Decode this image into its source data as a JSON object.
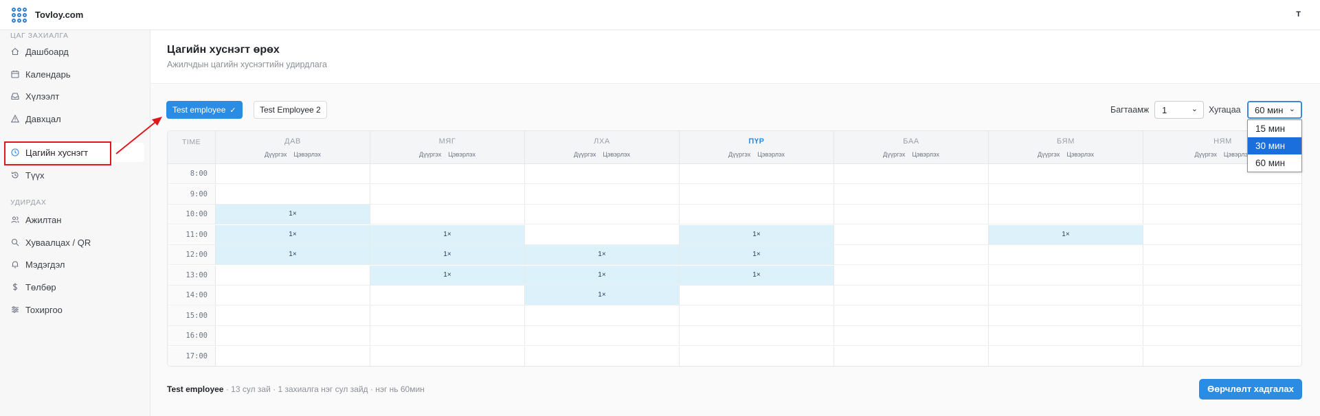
{
  "app": {
    "brand": "Tovloy.com",
    "user_initial": "T"
  },
  "sidebar": {
    "section1": "ЦАГ ЗАХИАЛГА",
    "section2": "УДИРДАХ",
    "items": [
      {
        "label": "Дашбоард",
        "icon": "home-icon"
      },
      {
        "label": "Календарь",
        "icon": "calendar-icon"
      },
      {
        "label": "Хүлээлт",
        "icon": "inbox-icon"
      },
      {
        "label": "Давхцал",
        "icon": "warning-icon"
      },
      {
        "label": "Цагийн хуснэгт",
        "icon": "clock-icon",
        "active": true
      },
      {
        "label": "Түүх",
        "icon": "history-icon"
      },
      {
        "label": "Ажилтан",
        "icon": "users-icon"
      },
      {
        "label": "Хуваалцах / QR",
        "icon": "search-icon"
      },
      {
        "label": "Мэдэгдэл",
        "icon": "bell-icon"
      },
      {
        "label": "Төлбөр",
        "icon": "dollar-icon"
      },
      {
        "label": "Тохиргоо",
        "icon": "sliders-icon"
      }
    ]
  },
  "page": {
    "title": "Цагийн хуснэгт өрөх",
    "subtitle": "Ажилчдын цагийн хуснэгтийн удирдлага"
  },
  "employees": [
    {
      "label": "Test employee",
      "selected": true
    },
    {
      "label": "Test Employee 2",
      "selected": false
    }
  ],
  "controls": {
    "capacity_label": "Багтаамж",
    "capacity_value": "1",
    "duration_label": "Хугацаа",
    "duration_value": "60 мин",
    "duration_options": [
      "15 мин",
      "30 мин",
      "60 мин"
    ],
    "highlighted_option": "30 мин"
  },
  "schedule": {
    "time_header": "TIME",
    "sub_labels": [
      "Дүүргэх",
      "Цэвэрлэх"
    ],
    "days": [
      "ДАВ",
      "МЯГ",
      "ЛХА",
      "ПҮР",
      "БАА",
      "БЯМ",
      "НЯМ"
    ],
    "today_index": 3,
    "times": [
      "8:00",
      "9:00",
      "10:00",
      "11:00",
      "12:00",
      "13:00",
      "14:00",
      "15:00",
      "16:00",
      "17:00"
    ],
    "cells": [
      [
        "",
        "",
        "",
        "",
        "",
        "",
        ""
      ],
      [
        "",
        "",
        "",
        "",
        "",
        "",
        ""
      ],
      [
        "1×",
        "",
        "",
        "",
        "",
        "",
        ""
      ],
      [
        "1×",
        "1×",
        "",
        "1×",
        "",
        "1×",
        ""
      ],
      [
        "1×",
        "1×",
        "1×",
        "1×",
        "",
        "",
        ""
      ],
      [
        "",
        "1×",
        "1×",
        "1×",
        "",
        "",
        ""
      ],
      [
        "",
        "",
        "1×",
        "",
        "",
        "",
        ""
      ],
      [
        "",
        "",
        "",
        "",
        "",
        "",
        ""
      ],
      [
        "",
        "",
        "",
        "",
        "",
        "",
        ""
      ],
      [
        "",
        "",
        "",
        "",
        "",
        "",
        ""
      ]
    ]
  },
  "footer": {
    "employee": "Test employee",
    "info": " · 13 сул зай · 1 захиалга нэг сул зайд · нэг нь 60мин",
    "save_label": "Өөрчлөлт хадгалах"
  },
  "colors": {
    "accent": "#2b8ce3",
    "slot_fill": "#ddf1fb",
    "annotation": "#e0161b"
  }
}
